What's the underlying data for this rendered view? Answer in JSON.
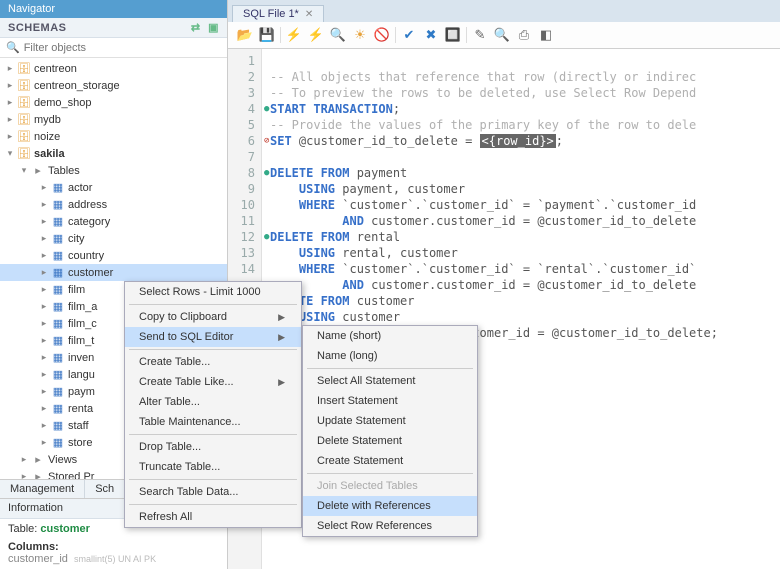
{
  "nav": {
    "title": "Navigator"
  },
  "schemas": {
    "label": "SCHEMAS",
    "filter_placeholder": "Filter objects"
  },
  "dbs": [
    "centreon",
    "centreon_storage",
    "demo_shop",
    "mydb",
    "noize"
  ],
  "sakila": {
    "name": "sakila",
    "tables_label": "Tables"
  },
  "tables": [
    "actor",
    "address",
    "category",
    "city",
    "country",
    "customer",
    "film",
    "film_a",
    "film_c",
    "film_t",
    "inven",
    "langu",
    "paym",
    "renta",
    "staff",
    "store"
  ],
  "selected_table": "customer",
  "views_label": "Views",
  "sp_label": "Stored Pr",
  "tabs": {
    "management": "Management",
    "schemas_tab": "Sch"
  },
  "info": {
    "label": "Information",
    "table_k": "Table:",
    "table_v": "customer",
    "cols": "Columns:",
    "col1": "customer_id",
    "col1_t": "smallint(5) UN AI PK"
  },
  "file_tab": "SQL File 1*",
  "toolbar_icons": [
    "📂",
    "💾",
    "|",
    "⚡",
    "⚡",
    "🔍",
    "☀",
    "🚫",
    "|",
    "✔",
    "✖",
    "🔲",
    "|",
    "✎",
    "🔍",
    "⎙",
    "◧"
  ],
  "lines": [
    "1",
    "2",
    "3",
    "4",
    "5",
    "6",
    "7",
    "8",
    "9",
    "10",
    "11",
    "12",
    "13",
    "14"
  ],
  "marks": {
    "l4": "●",
    "l6": "⊘",
    "l8": "●",
    "l12": "●"
  },
  "code": {
    "c1": "-- All objects that reference that row (directly or indirec",
    "c2": "-- To preview the rows to be deleted, use Select Row Depend",
    "c3a": "START",
    "c3b": " TRANSACTION",
    "c3c": ";",
    "c4": "-- Provide the values of the primary key of the row to dele",
    "c5a": "SET",
    "c5b": " @customer_id_to_delete = ",
    "c5h": "<{row_id}>",
    "c5c": ";",
    "c6a": "DELETE FROM",
    "c6b": " payment",
    "c7a": "USING",
    "c7b": " payment, customer",
    "c8a": "WHERE",
    "c8b": " `customer`.`customer_id` = `payment`.`customer_id",
    "c9a": "AND",
    "c9b": " customer.customer_id = @customer_id_to_delete",
    "c10a": "DELETE FROM",
    "c10b": " rental",
    "c11a": "USING",
    "c11b": " rental, customer",
    "c12a": "WHERE",
    "c12b": " `customer`.`customer_id` = `rental`.`customer_id`",
    "c13a": "AND",
    "c13b": " customer.customer_id = @customer_id_to_delete",
    "c14a": "DELETE FROM",
    "c14b": " customer",
    "c15a": "USING",
    "c15b": " customer",
    "c16b": "stomer_id = @customer_id_to_delete;"
  },
  "menu1": {
    "i1": "Select Rows - Limit 1000",
    "i2": "Copy to Clipboard",
    "i3": "Send to SQL Editor",
    "i4": "Create Table...",
    "i5": "Create Table Like...",
    "i6": "Alter Table...",
    "i7": "Table Maintenance...",
    "i8": "Drop Table...",
    "i9": "Truncate Table...",
    "i10": "Search Table Data...",
    "i11": "Refresh All"
  },
  "menu2": {
    "j1": "Name (short)",
    "j2": "Name (long)",
    "j3": "Select All Statement",
    "j4": "Insert Statement",
    "j5": "Update Statement",
    "j6": "Delete Statement",
    "j7": "Create Statement",
    "j8": "Join Selected Tables",
    "j9": "Delete with References",
    "j10": "Select Row References"
  }
}
